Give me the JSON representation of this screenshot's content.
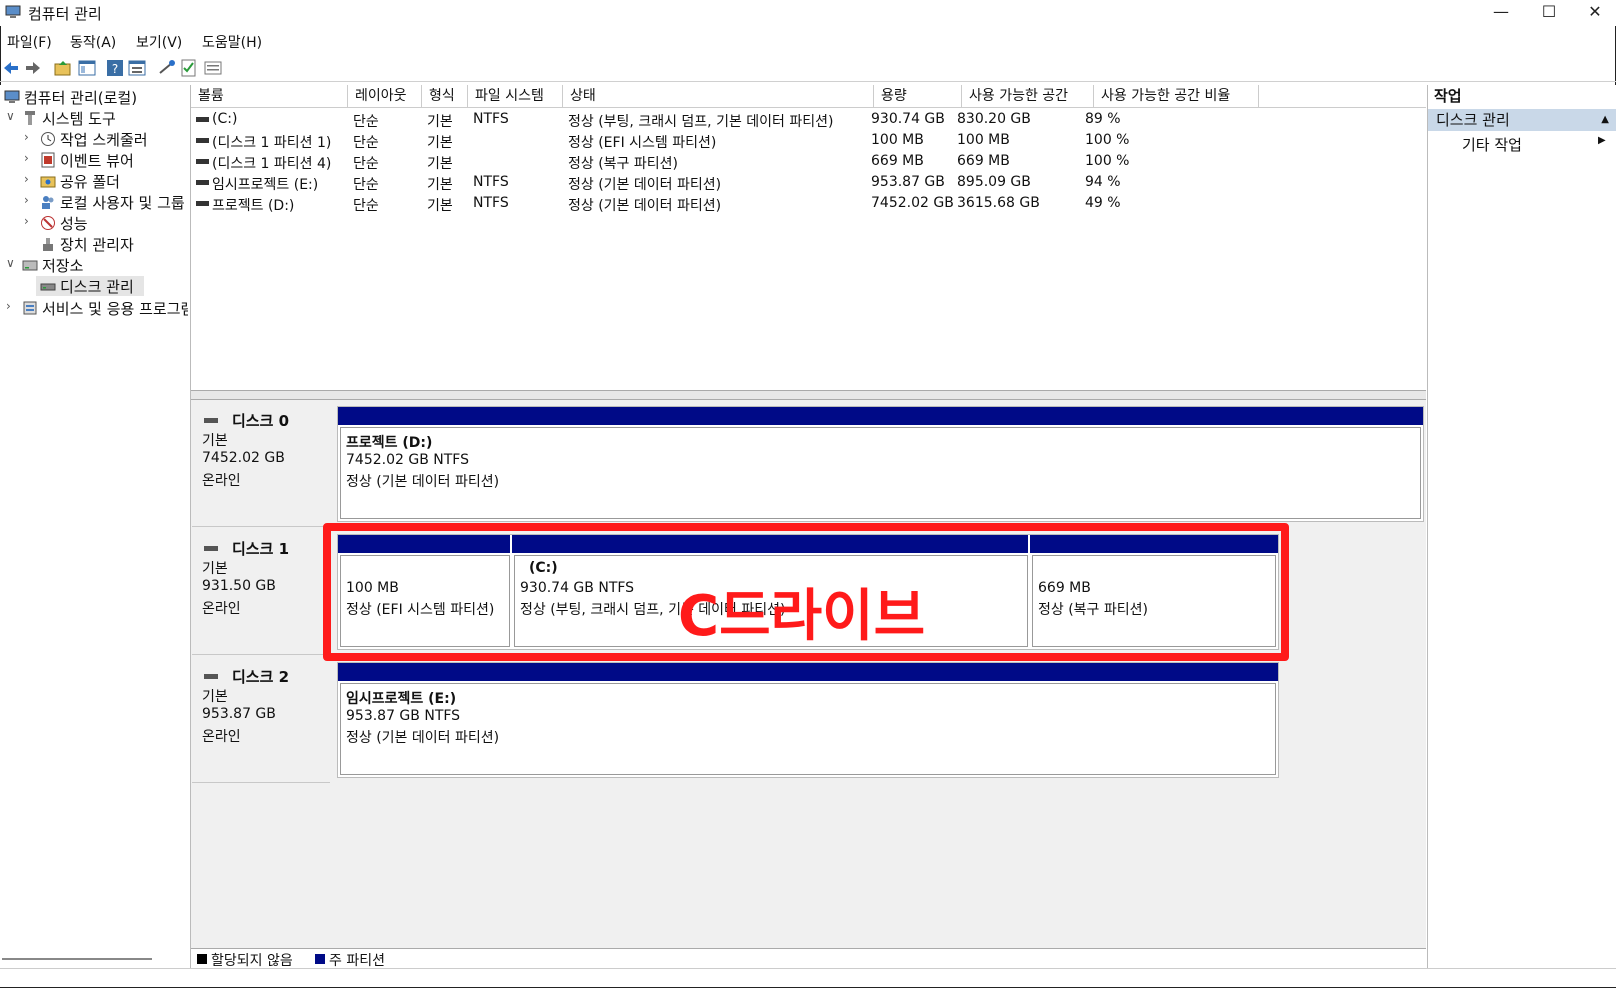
{
  "window": {
    "title": "컴퓨터 관리",
    "controls": [
      "—",
      "☐",
      "✕"
    ]
  },
  "menu": [
    "파일(F)",
    "동작(A)",
    "보기(V)",
    "도움말(H)"
  ],
  "tree": [
    {
      "label": "컴퓨터 관리(로컬)",
      "chev": "",
      "icon": "computer-icon"
    },
    {
      "label": "시스템 도구",
      "chev": "v",
      "icon": "tools-icon"
    },
    {
      "label": "작업 스케줄러",
      "chev": ">",
      "icon": "clock-icon"
    },
    {
      "label": "이벤트 뷰어",
      "chev": ">",
      "icon": "event-viewer-icon"
    },
    {
      "label": "공유 폴더",
      "chev": ">",
      "icon": "shared-folder-icon"
    },
    {
      "label": "로컬 사용자 및 그룹",
      "chev": ">",
      "icon": "users-icon"
    },
    {
      "label": "성능",
      "chev": ">",
      "icon": "performance-icon"
    },
    {
      "label": "장치 관리자",
      "chev": "",
      "icon": "device-manager-icon"
    },
    {
      "label": "저장소",
      "chev": "v",
      "icon": "storage-icon"
    },
    {
      "label": "디스크 관리",
      "chev": "",
      "icon": "disk-icon"
    },
    {
      "label": "서비스 및 응용 프로그램",
      "chev": ">",
      "icon": "services-icon"
    }
  ],
  "columns": [
    "볼륨",
    "레이아웃",
    "형식",
    "파일 시스템",
    "상태",
    "용량",
    "사용 가능한 공간",
    "사용 가능한 공간 비율"
  ],
  "volumes": [
    [
      "(C:)",
      "단순",
      "기본",
      "NTFS",
      "정상 (부팅, 크래시 덤프, 기본 데이터 파티션)",
      "930.74 GB",
      "830.20 GB",
      "89 %"
    ],
    [
      "(디스크 1 파티션 1)",
      "단순",
      "기본",
      "",
      "정상 (EFI 시스템 파티션)",
      "100 MB",
      "100 MB",
      "100 %"
    ],
    [
      "(디스크 1 파티션 4)",
      "단순",
      "기본",
      "",
      "정상 (복구 파티션)",
      "669 MB",
      "669 MB",
      "100 %"
    ],
    [
      "임시프로젝트 (E:)",
      "단순",
      "기본",
      "NTFS",
      "정상 (기본 데이터 파티션)",
      "953.87 GB",
      "895.09 GB",
      "94 %"
    ],
    [
      "프로젝트 (D:)",
      "단순",
      "기본",
      "NTFS",
      "정상 (기본 데이터 파티션)",
      "7452.02 GB",
      "3615.68 GB",
      "49 %"
    ]
  ],
  "disks": [
    {
      "name": "디스크 0",
      "type": "기본",
      "size": "7452.02 GB",
      "status": "온라인",
      "partitions": [
        {
          "name": "프로젝트  (D:)",
          "size": "7452.02 GB NTFS",
          "status": "정상 (기본 데이터 파티션)"
        }
      ]
    },
    {
      "name": "디스크 1",
      "type": "기본",
      "size": "931.50 GB",
      "status": "온라인",
      "partitions": [
        {
          "name": "",
          "size": "100 MB",
          "status": "정상 (EFI 시스템 파티션)"
        },
        {
          "name": "(C:)",
          "size": "930.74 GB NTFS",
          "status": "정상 (부팅, 크래시 덤프, 기본 데이터 파티션)"
        },
        {
          "name": "",
          "size": "669 MB",
          "status": "정상 (복구 파티션)"
        }
      ]
    },
    {
      "name": "디스크 2",
      "type": "기본",
      "size": "953.87 GB",
      "status": "온라인",
      "partitions": [
        {
          "name": "임시프로젝트  (E:)",
          "size": "953.87 GB NTFS",
          "status": "정상 (기본 데이터 파티션)"
        }
      ]
    }
  ],
  "legend": [
    {
      "label": "할당되지 않음",
      "color": "#000000"
    },
    {
      "label": "주 파티션",
      "color": "#000a87"
    }
  ],
  "annotation": {
    "text": "C드라이브",
    "color": "#ff1a1a"
  },
  "actions": {
    "title": "작업",
    "selected": "디스크 관리",
    "item": "기타 작업"
  }
}
